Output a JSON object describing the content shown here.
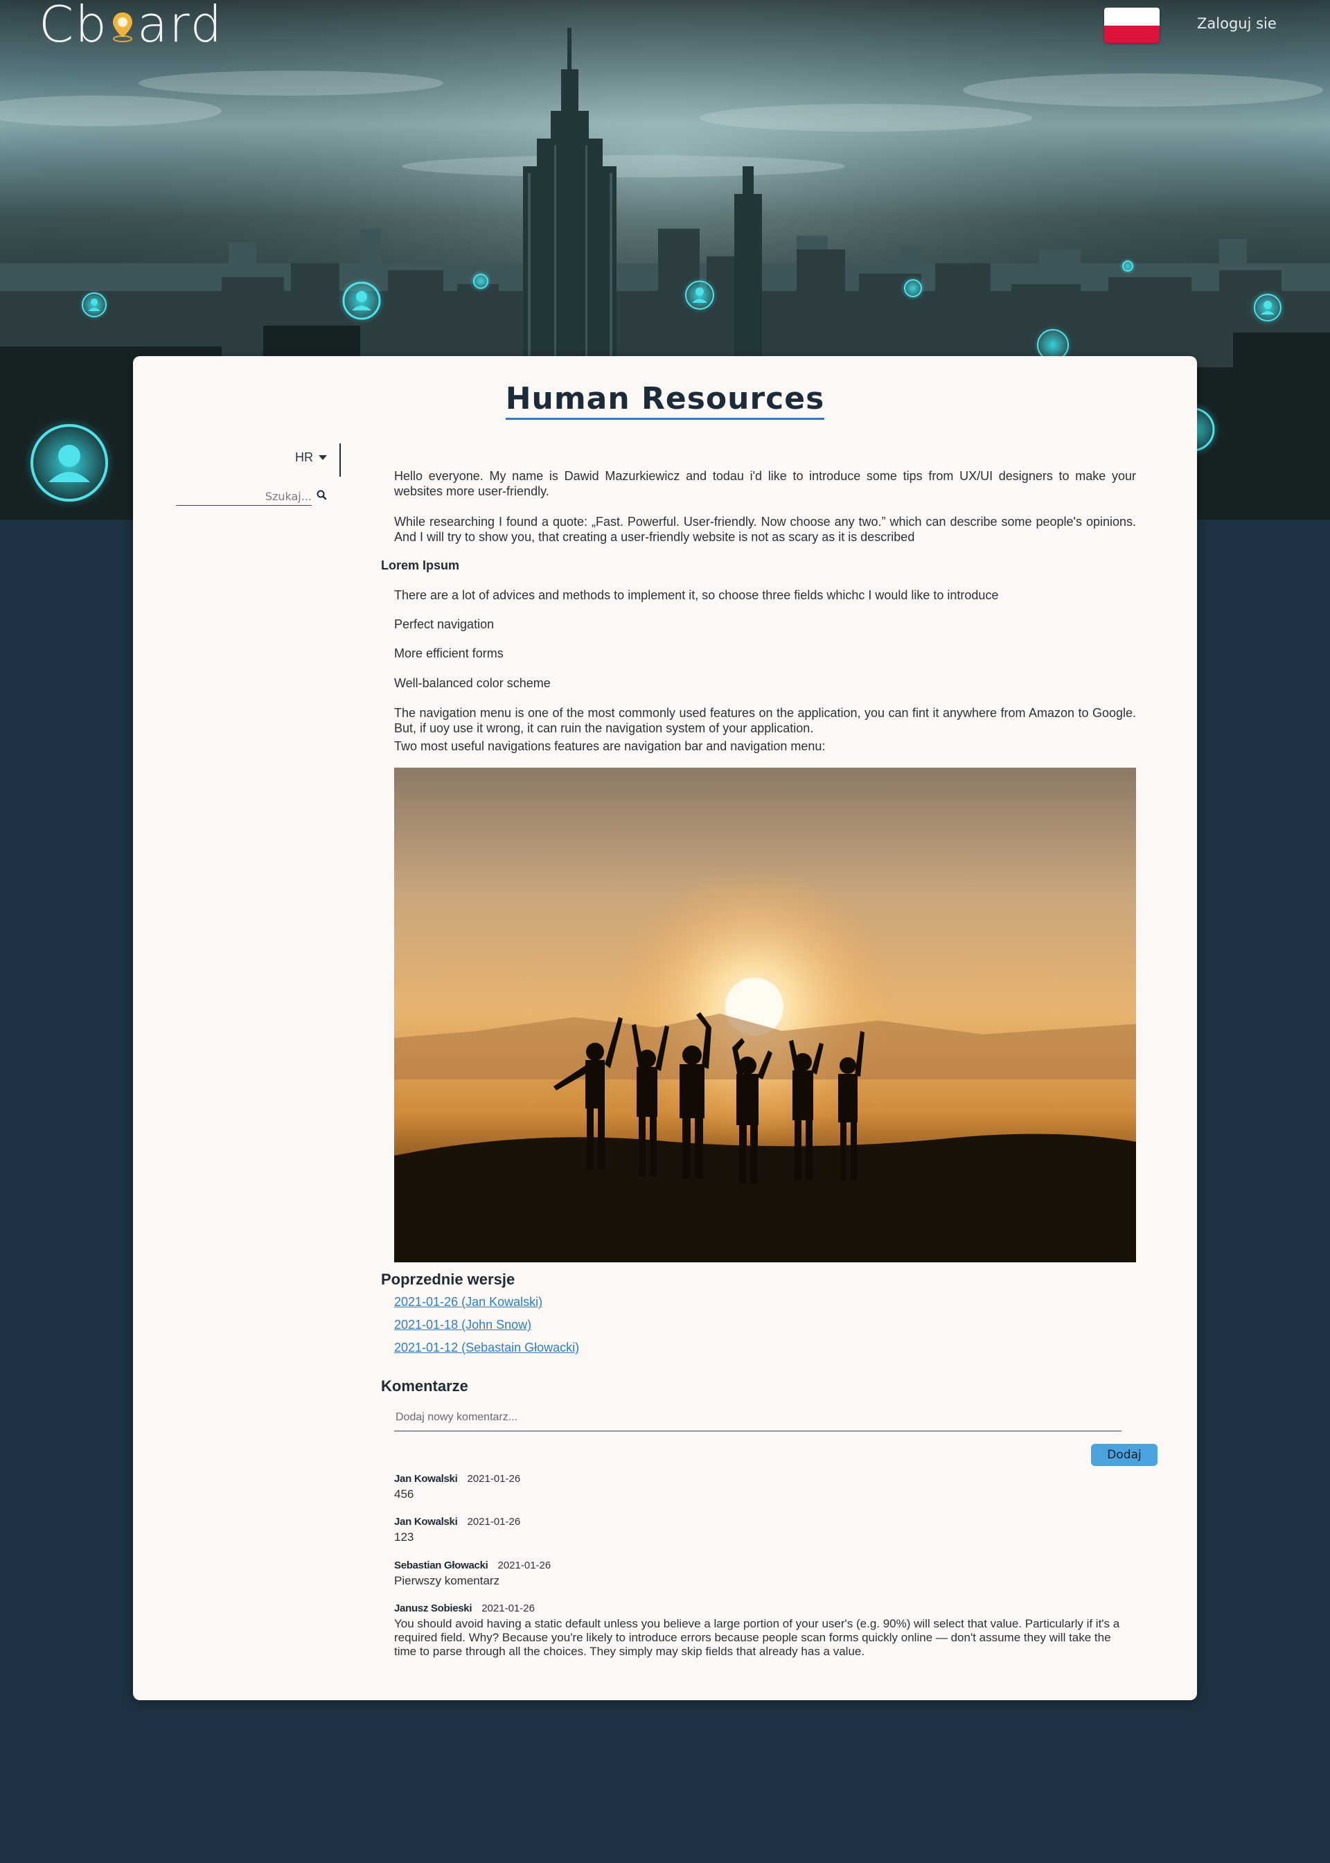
{
  "header": {
    "logo_left": "Cb",
    "logo_right": "ard",
    "login_label": "Zaloguj sie",
    "flag": "poland-flag-icon"
  },
  "page": {
    "title": "Human Resources"
  },
  "sidebar": {
    "category_label": "HR",
    "search_placeholder": "Szukaj..."
  },
  "article": {
    "intro": [
      "Hello everyone. My name is Dawid Mazurkiewicz and todau i'd like to introduce some tips from UX/UI designers to make your websites more user-friendly.",
      "While researching I found a quote: „Fast. Powerful. User-friendly. Now choose any two.” which can describe some people's opinions. And I will try to show you, that creating a user-friendly website is not as scary as it is described"
    ],
    "subheading": "Lorem Ipsum",
    "paragraphs": [
      "There are a lot of advices and methods to implement it, so choose three fields whichc I would like to introduce",
      "Perfect navigation",
      "More efficient forms",
      "Well-balanced color scheme",
      "The navigation menu is one of the most commonly used features on the application, you can fint it anywhere from Amazon to Google. But, if uoy use it wrong, it can ruin the navigation system of your application.",
      "Two most useful navigations features are navigation bar and navigation menu:"
    ]
  },
  "versions": {
    "heading": "Poprzednie wersje",
    "links": [
      "2021-01-26 (Jan Kowalski)",
      "2021-01-18 (John Snow)",
      "2021-01-12 (Sebastain Głowacki)"
    ]
  },
  "comments": {
    "heading": "Komentarze",
    "input_placeholder": "Dodaj nowy komentarz...",
    "add_label": "Dodaj",
    "items": [
      {
        "author": "Jan Kowalski",
        "date": "2021-01-26",
        "text": "456"
      },
      {
        "author": "Jan Kowalski",
        "date": "2021-01-26",
        "text": "123"
      },
      {
        "author": "Sebastian Głowacki",
        "date": "2021-01-26",
        "text": "Pierwszy komentarz"
      },
      {
        "author": "Janusz Sobieski",
        "date": "2021-01-26",
        "text": "You should avoid having a static default unless you believe a large portion of your user's (e.g. 90%) will select that value. Particularly if it's a required field. Why? Because you're likely to introduce errors because people scan forms quickly online — don't assume they will take the time to parse through all the choices. They simply may skip fields that already has a value."
      }
    ]
  },
  "colors": {
    "background": "#1f3243",
    "card": "#fcf8f6",
    "accent": "#2d7ec9",
    "button": "#4aa3dd"
  }
}
